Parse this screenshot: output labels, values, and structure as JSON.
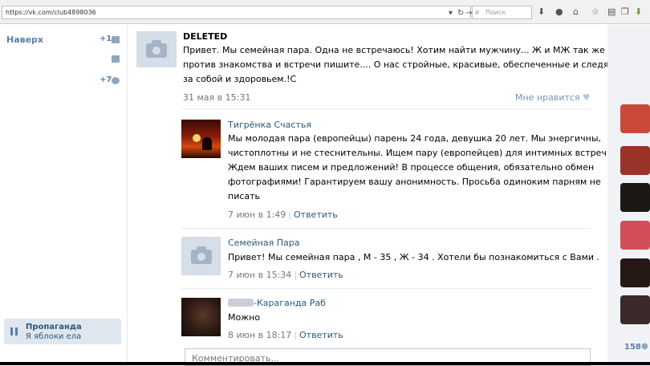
{
  "browser": {
    "url": "https://vk.com/club4898036",
    "search_placeholder": "Поиск"
  },
  "sidebar": {
    "back_to_top": "Наверх",
    "messages_count": "+1",
    "notifications_count": "+7",
    "promo_title": "Пропаганда",
    "promo_subtitle": "Я яблоки ела"
  },
  "post": {
    "author": "DELETED",
    "lines": [
      "Привет. Мы семейная пара. Одна не встречаюсь! Хотим найти мужчину... Ж и МЖ так же не",
      "против знакомства и встречи пишите.... О нас стройные, красивые, обеспеченные и следящие",
      "за собой и здоровьем.!С"
    ],
    "date": "31 мая в 15:31",
    "like_label": "Мне нравится"
  },
  "comments": [
    {
      "author": "Тигрёнка Счастья",
      "lines": [
        "Мы молодая пара (европейцы) парень 24 года, девушка 20 лет. Мы энергичны,",
        "чистоплотны и не стеснительны. Ищем пару (европейцев) для интимных встреч.",
        "Ждем ваших писем и предложений! В процессе общения, обязательно обмен",
        "фотографиями! Гарантируем вашу анонимность. Просьба одиноким парням не",
        "писать"
      ],
      "date": "7 июн в 1:49",
      "reply": "Ответить"
    },
    {
      "author": "Семейная Пара",
      "lines": [
        "Привет! Мы семейная пара , М - 35 , Ж - 34 . Хотели бы познакомиться с Вами ."
      ],
      "date": "7 июн в 15:34",
      "reply": "Ответить"
    },
    {
      "author": "-Караганда Раб",
      "lines": [
        "Можно"
      ],
      "date": "8 июн в 18:17",
      "reply": "Ответить"
    }
  ],
  "comment_input_placeholder": "Комментировать...",
  "right_edge": {
    "members_count": "158"
  }
}
